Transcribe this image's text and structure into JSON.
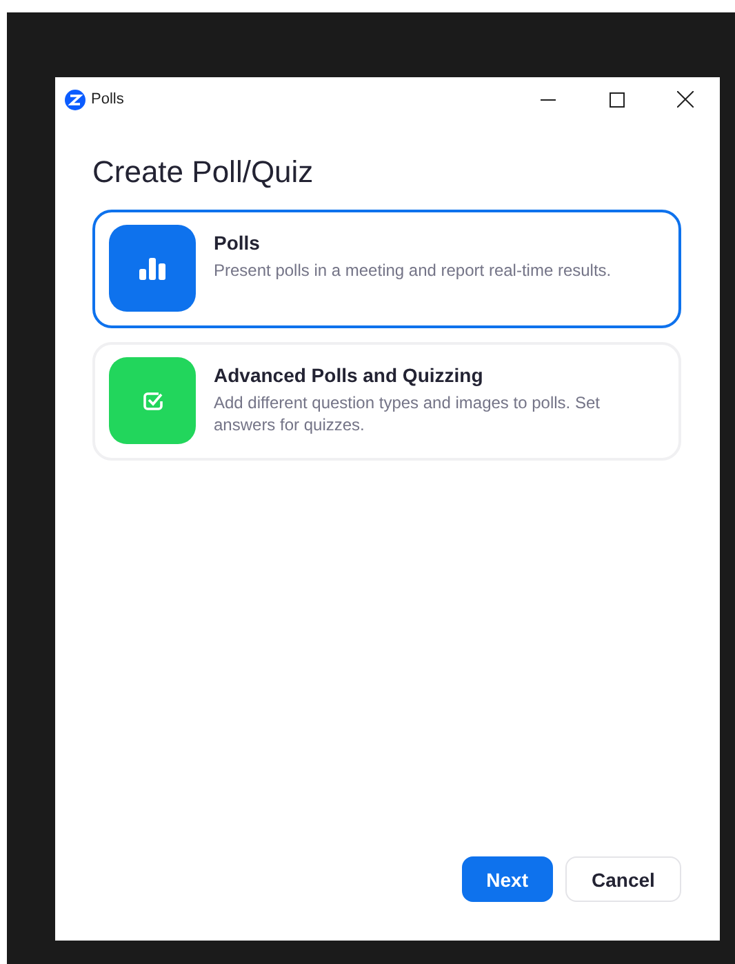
{
  "window": {
    "title": "Polls"
  },
  "heading": "Create Poll/Quiz",
  "options": [
    {
      "kind": "chart",
      "title": "Polls",
      "description": "Present polls in a meeting and report real-time results.",
      "selected": true,
      "color": "#0e72ed"
    },
    {
      "kind": "check",
      "title": "Advanced Polls and Quizzing",
      "description": "Add different question types and images to polls. Set answers for quizzes.",
      "selected": false,
      "color": "#22d65c"
    }
  ],
  "buttons": [
    {
      "kind": "primary",
      "label": "Next"
    },
    {
      "kind": "secondary",
      "label": "Cancel"
    }
  ]
}
